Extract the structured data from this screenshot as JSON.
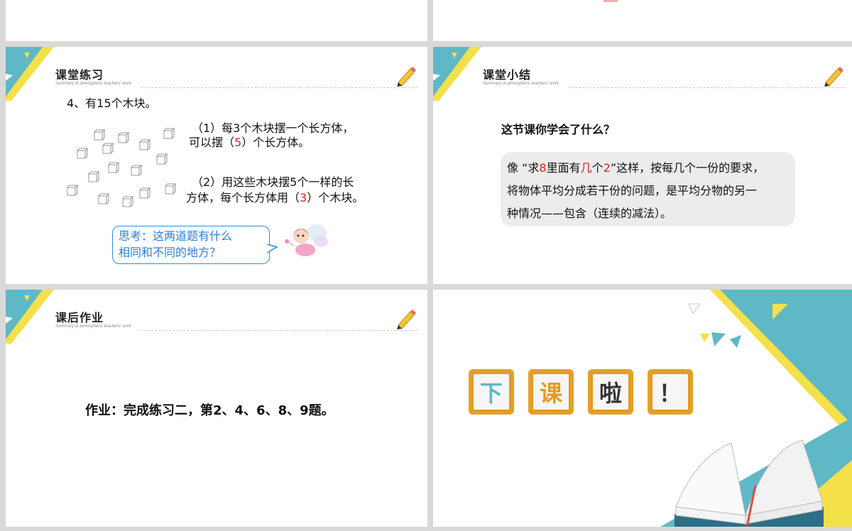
{
  "colors": {
    "teal": "#5fb8c6",
    "yellow": "#f3e04a",
    "red": "#e02020",
    "blue": "#2b7fd4",
    "orange": "#e49a1f"
  },
  "header_subtitle": "Summary of atmospheric teachers' work",
  "slide_practice": {
    "title": "课堂练习",
    "q4": "4、有15个木块。",
    "q1_line1": "（1）每3个木块摆一个长方体，",
    "q1_line2_a": "可以摆（",
    "q1_answer": "5",
    "q1_line2_b": "）个长方体。",
    "q2_line1": "（2）用这些木块摆5个一样的长",
    "q2_line2_a": "方体，每个长方体用（",
    "q2_answer": "3",
    "q2_line2_b": "）个木块。",
    "think_line1": "思考：这两道题有什么",
    "think_line2": "相同和不同的地方？",
    "fairy_icon": "fairy-icon"
  },
  "slide_summary": {
    "title": "课堂小结",
    "question": "这节课你学会了什么？",
    "line1_a": "像 “求",
    "line1_n1": "8",
    "line1_b": "里面有",
    "line1_c": "几",
    "line1_d": "个",
    "line1_n2": "2",
    "line1_e": "”这样，按每几个一份的要求，",
    "line2": "将物体平均分成若干份的问题，是平均分物的另一",
    "line3": "种情况——包含（连续的减法）。"
  },
  "slide_homework": {
    "title": "课后作业",
    "text": "作业：完成练习二，第2、4、6、8、9题。"
  },
  "slide_end": {
    "keys": [
      {
        "char": "下",
        "color": "#5fb8c6"
      },
      {
        "char": "课",
        "color": "#e49a1f"
      },
      {
        "char": "啦",
        "color": "#333333"
      },
      {
        "char": "！",
        "color": "#333333"
      }
    ],
    "book_icon": "open-book-icon"
  }
}
